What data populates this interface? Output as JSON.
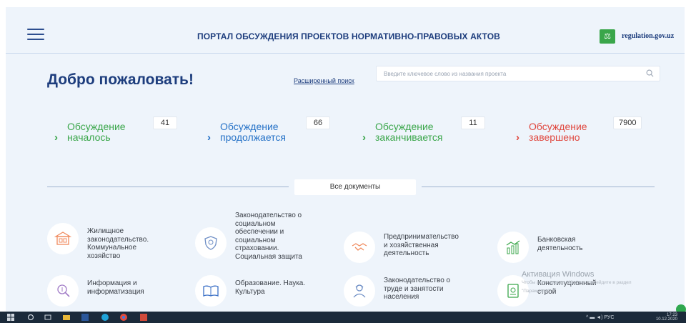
{
  "header": {
    "title": "ПОРТАЛ ОБСУЖДЕНИЯ ПРОЕКТОВ НОРМАТИВНО-ПРАВОВЫХ АКТОВ",
    "logo_text": "regulation.gov.uz",
    "logo_badge": "⚖"
  },
  "welcome": "Добро пожаловать!",
  "search": {
    "advanced_link": "Расширенный поиск",
    "placeholder": "Введите ключевое слово из названия проекта"
  },
  "statuses": [
    {
      "label": "Обсуждение\nначалось",
      "count": "41",
      "color": "#3aa64a"
    },
    {
      "label": "Обсуждение\nпродолжается",
      "count": "66",
      "color": "#2672c7"
    },
    {
      "label": "Обсуждение\nзаканчивается",
      "count": "11",
      "color": "#3aa64a"
    },
    {
      "label": "Обсуждение\nзавершено",
      "count": "7900",
      "color": "#e0483f"
    }
  ],
  "all_documents": "Все документы",
  "categories": [
    {
      "label": "Жилищное\nзаконодательство.\nКоммунальное\nхозяйство",
      "icon": "building-icon"
    },
    {
      "label": "Законодательство о\nсоциальном\nобеспечении и\nсоциальном\nстраховании.\nСоциальная защита",
      "icon": "shield-hands-icon"
    },
    {
      "label": "Предпринимательство\nи хозяйственная\nдеятельность",
      "icon": "handshake-icon"
    },
    {
      "label": "Банковская\nдеятельность",
      "icon": "bank-chart-icon"
    },
    {
      "label": "Информация и\nинформатизация",
      "icon": "magnifier-icon"
    },
    {
      "label": "Образование. Наука.\nКультура",
      "icon": "open-book-icon"
    },
    {
      "label": "Законодательство о\nтруде и занятости\nнаселения",
      "icon": "worker-icon"
    },
    {
      "label": "Конституционный\nстрой",
      "icon": "constitution-icon"
    }
  ],
  "watermark": {
    "title": "Активация Windows",
    "sub1": "Чтобы активировать Windows, перейдите в раздел",
    "sub2": "\"Параметры\"."
  },
  "tray": {
    "time": "17:23",
    "date": "10.12.2020",
    "lang": "РУС"
  }
}
